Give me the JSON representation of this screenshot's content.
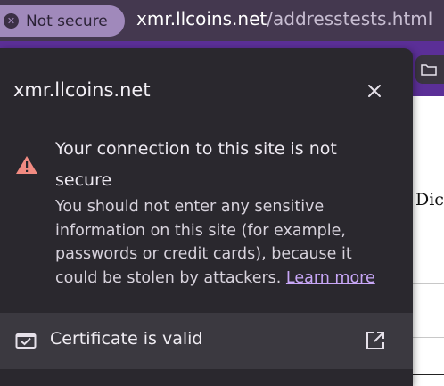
{
  "addressbar": {
    "security_chip_label": "Not secure",
    "url_host": "xmr.llcoins.net",
    "url_path": "/addresstests.html"
  },
  "background_page": {
    "partial_word": "Dic"
  },
  "popup": {
    "title": "xmr.llcoins.net",
    "warning_heading": "Your connection to this site is not secure",
    "warning_body": "You should not enter any sensitive information on this site (for example, passwords or credit cards), because it could be stolen by attackers.",
    "learn_more_label": "Learn more",
    "certificate_label": "Certificate is valid"
  },
  "colors": {
    "popup_background": "#2a282e",
    "certificate_row_background": "#3b3940",
    "chip_background": "#a089bb",
    "warning_icon": "#f28b82",
    "link": "#c8a7f7",
    "toolbar": "#5b2f97"
  },
  "icons": {
    "chip": "not-secure-x-icon",
    "close": "close-icon",
    "warning": "warning-triangle-icon",
    "certificate": "certificate-check-icon",
    "external": "open-external-icon",
    "toolbar": "folder-icon"
  }
}
